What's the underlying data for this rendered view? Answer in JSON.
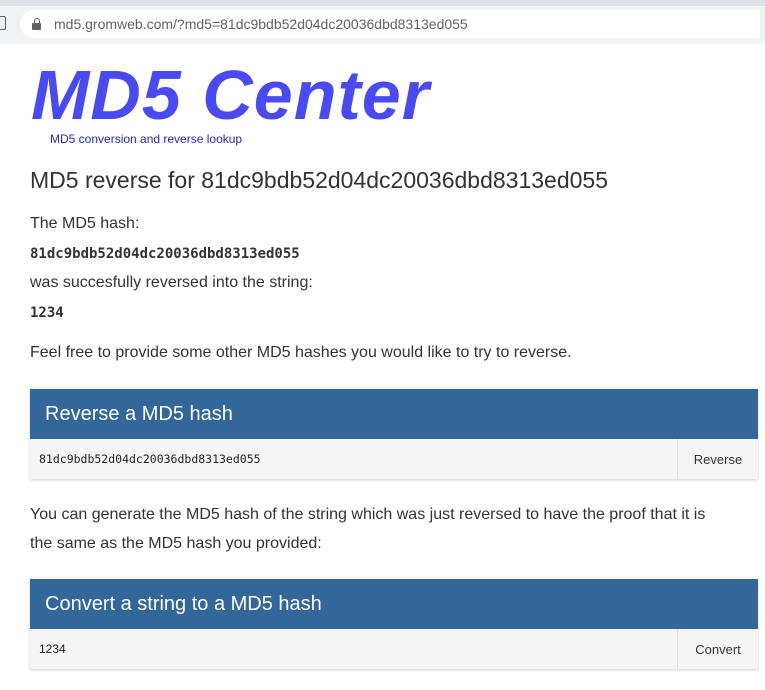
{
  "browser": {
    "url": "md5.gromweb.com/?md5=81dc9bdb52d04dc20036dbd8313ed055"
  },
  "site": {
    "logo": "MD5 Center",
    "tagline": "MD5 conversion and reverse lookup",
    "brand_color": "#4a4af4"
  },
  "result": {
    "heading": "MD5 reverse for 81dc9bdb52d04dc20036dbd8313ed055",
    "hash_label": "The MD5 hash:",
    "hash_value": "81dc9bdb52d04dc20036dbd8313ed055",
    "success_text": "was succesfully reversed into the string:",
    "string_value": "1234",
    "invite_text": "Feel free to provide some other MD5 hashes you would like to try to reverse."
  },
  "reverse_panel": {
    "title": "Reverse a MD5 hash",
    "input_value": "81dc9bdb52d04dc20036dbd8313ed055",
    "button_label": "Reverse",
    "header_color": "#336699"
  },
  "proof": {
    "line1": "You can generate the MD5 hash of the string which was just reversed to have the proof that it is",
    "line2": "the same as the MD5 hash you provided:"
  },
  "convert_panel": {
    "title": "Convert a string to a MD5 hash",
    "input_value": "1234",
    "button_label": "Convert"
  }
}
